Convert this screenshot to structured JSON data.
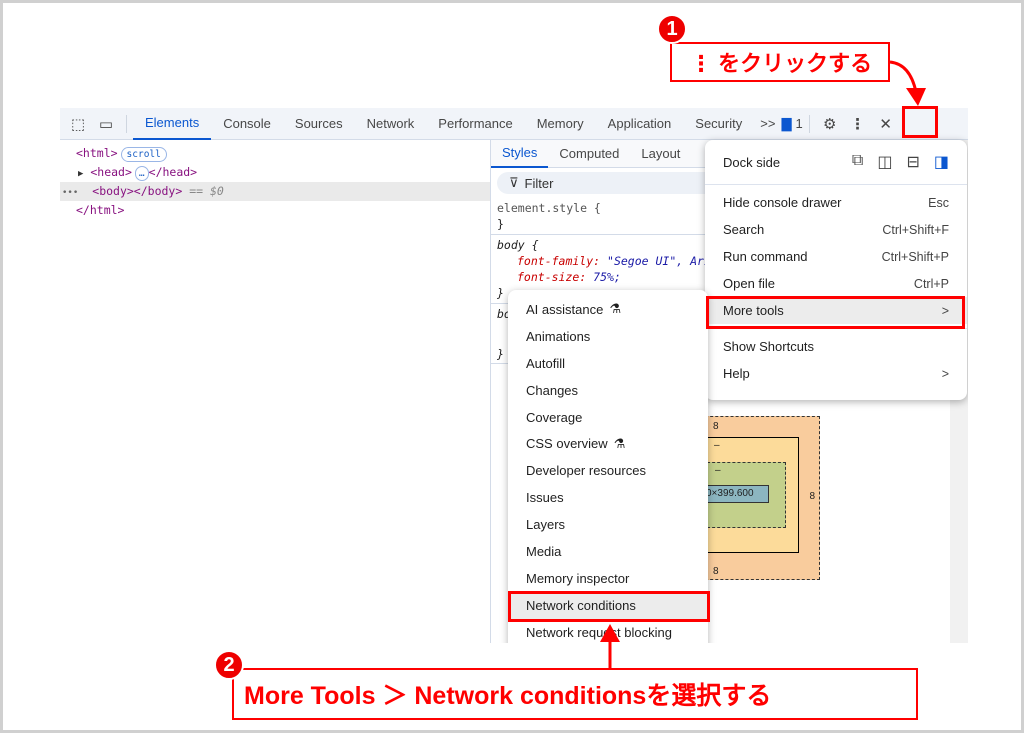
{
  "toolbar": {
    "tabs": [
      "Elements",
      "Console",
      "Sources",
      "Network",
      "Performance",
      "Memory",
      "Application",
      "Security"
    ],
    "active": "Elements",
    "overflow": ">>",
    "issues_count": "1"
  },
  "elements": {
    "html_open": "<html>",
    "scroll_badge": "scroll",
    "head": "<head>",
    "head_close": "</head>",
    "ellipsis": "…",
    "body": "<body></body>",
    "body_ref": "== $0",
    "html_close": "</html>",
    "dots": "•••"
  },
  "styles": {
    "tabs": [
      "Styles",
      "Computed",
      "Layout"
    ],
    "filter": "Filter",
    "element_style": "element.style {",
    "close_brace": "}",
    "body_selector": "body {",
    "prop1_name": "font-family",
    "prop1_value": "\"Segoe UI\", Ari",
    "prop2_name": "font-size",
    "prop2_value": "75%;",
    "partial": "bo"
  },
  "main_menu": {
    "dock_side": "Dock side",
    "items": [
      {
        "label": "Hide console drawer",
        "shortcut": "Esc"
      },
      {
        "label": "Search",
        "shortcut": "Ctrl+Shift+F"
      },
      {
        "label": "Run command",
        "shortcut": "Ctrl+Shift+P"
      },
      {
        "label": "Open file",
        "shortcut": "Ctrl+P"
      },
      {
        "label": "More tools",
        "shortcut": ">"
      }
    ],
    "items2": [
      {
        "label": "Show Shortcuts",
        "shortcut": ""
      },
      {
        "label": "Help",
        "shortcut": ">"
      }
    ]
  },
  "more_tools": {
    "items": [
      "AI assistance",
      "Animations",
      "Autofill",
      "Changes",
      "Coverage",
      "CSS overview",
      "Developer resources",
      "Issues",
      "Layers",
      "Media",
      "Memory inspector",
      "Network conditions",
      "Network request blocking"
    ],
    "experimental": [
      "AI assistance",
      "CSS overview"
    ],
    "highlighted": "Network conditions"
  },
  "box_model": {
    "margin_top": "8",
    "margin_bottom": "8",
    "margin_right": "8",
    "border": "–",
    "padding": "–",
    "content": "0×399.600"
  },
  "annotations": {
    "step1_num": "1",
    "step1_text": "⋮ をクリックする",
    "step2_num": "2",
    "step2_text": "More Tools ＞ Network conditionsを選択する",
    "color": "#ff0000"
  }
}
